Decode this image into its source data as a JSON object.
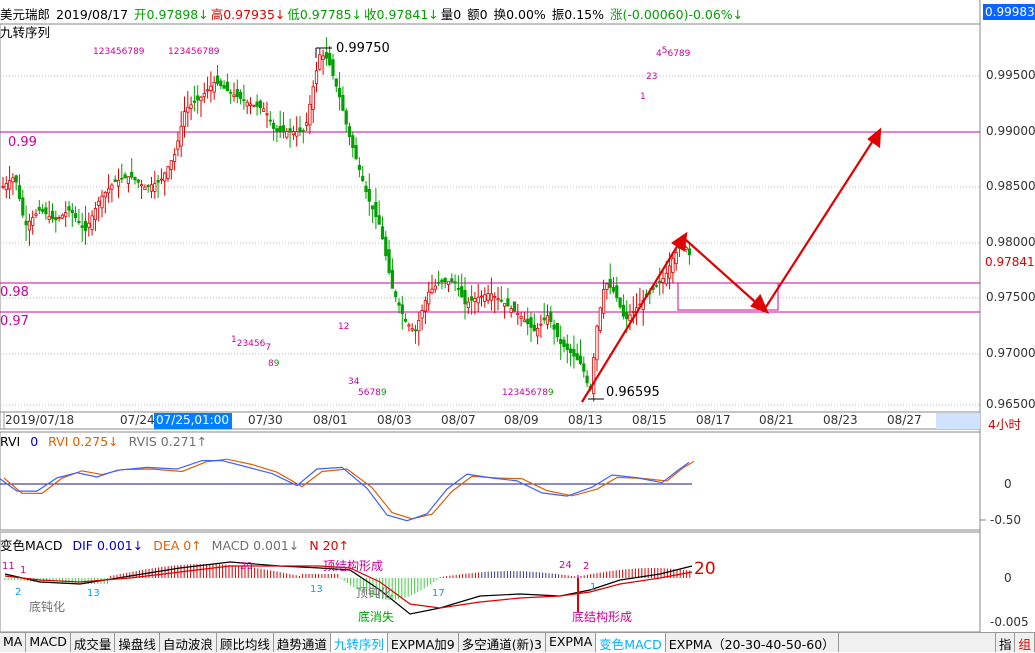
{
  "header": {
    "symbol": "美元瑞郎",
    "date": "2019/08/17",
    "open": "开0.97898↓",
    "high": "高0.97935↓",
    "low": "低0.97785↓",
    "close": "收0.97841↓",
    "volume": "量0",
    "amount": "额0",
    "turnover": "换0.00%",
    "amplitude": "振0.15%",
    "change": "涨(-0.00060)-0.06%↓",
    "indicator_name": "九转序列"
  },
  "price_axis": {
    "top_box": "0.99983",
    "current_price": "0.97841",
    "ticks": [
      "0.99500",
      "0.99000",
      "0.98500",
      "0.98000",
      "0.97500",
      "0.97000",
      "0.96500"
    ]
  },
  "lines": {
    "l099": "0.99",
    "l098": "0.98",
    "l097": "0.97"
  },
  "price_annotations": {
    "high_label": "0.99750",
    "low_label": "0.96595"
  },
  "nine_labels": {
    "a": "123456789",
    "b": "123456789",
    "c": "4",
    "c2": "5",
    "c3": "6789",
    "d": "23",
    "e": "1",
    "f": "12",
    "g": "1",
    "g2": "23456",
    "g3": "7",
    "g4": "8",
    "g5": "9",
    "h": "34",
    "h2": "5678",
    "h3": "9",
    "i": "12345678",
    "i2": "9"
  },
  "x_axis": {
    "labels": [
      "2019/07/18",
      "07/24",
      "07/25,01:00",
      "07/30",
      "08/01",
      "08/03",
      "08/07",
      "08/09",
      "08/13",
      "08/15",
      "08/17",
      "08/21",
      "08/23",
      "08/27"
    ],
    "period": "4小时"
  },
  "rvi": {
    "title": "RVI",
    "v0": "0",
    "rvi": "RVI 0.275↓",
    "rvis": "RVIS 0.271↑",
    "ticks": [
      "0",
      "-0.50"
    ]
  },
  "macd": {
    "title": "变色MACD",
    "dif": "DIF 0.001↓",
    "dea": "DEA 0↑",
    "macd": "MACD 0.001↓",
    "n": "N 20↑",
    "ticks": [
      "0",
      "-0.005"
    ],
    "big_num": "20",
    "annotations": {
      "a11": "11",
      "a1": "1",
      "a2": "2",
      "a13": "13",
      "a29": "29",
      "a13b": "13",
      "a17": "17",
      "a24": "24",
      "a2b": "2",
      "a1b": "1",
      "t1": "底钝化",
      "t2": "顶结构形成",
      "t3": "顶钝化",
      "t4": "底消失",
      "t5": "底结构形成"
    }
  },
  "toolbar": {
    "items": [
      "MA",
      "MACD",
      "成交量",
      "操盘线",
      "自动波浪",
      "顾比均线",
      "趋势通道",
      "九转序列",
      "EXPMA加9",
      "多空通道(新)3",
      "EXPMA",
      "变色MACD",
      "EXPMA（20-30-40-50-60）"
    ],
    "active": [
      "九转序列",
      "变色MACD"
    ],
    "right1": "指",
    "right2": "组"
  },
  "colors": {
    "up": "#e00000",
    "down": "#00a000",
    "magenta_line": "#d000a0",
    "arrow": "#e00000"
  },
  "chart_data": [
    {
      "type": "candlestick",
      "title": "美元瑞郎 2019/08/17",
      "ylim": [
        0.9645,
        0.99983
      ],
      "x": [
        "2019/07/18",
        "07/24",
        "07/30",
        "08/01",
        "08/03",
        "08/07",
        "08/09",
        "08/13",
        "08/15",
        "08/17"
      ],
      "series": [
        {
          "name": "收",
          "values": [
            0.985,
            0.986,
            0.9945,
            0.9895,
            0.9725,
            0.974,
            0.973,
            0.966,
            0.977,
            0.97841
          ]
        }
      ],
      "annotations": [
        "0.99750",
        "0.96595"
      ]
    },
    {
      "type": "line",
      "title": "RVI",
      "series": [
        {
          "name": "RVI",
          "values": [
            0.1,
            -0.1,
            0.2,
            0.25,
            0.1,
            -0.2,
            -0.3,
            -0.6,
            -0.2,
            0.0,
            -0.05,
            -0.1,
            0.1,
            0.0,
            0.275
          ]
        },
        {
          "name": "RVIS",
          "values": [
            0.05,
            -0.05,
            0.15,
            0.25,
            0.15,
            -0.15,
            -0.3,
            -0.55,
            -0.25,
            -0.05,
            -0.05,
            -0.1,
            0.05,
            0.05,
            0.271
          ]
        }
      ],
      "ylim": [
        -0.6,
        0.6
      ]
    },
    {
      "type": "bar",
      "title": "变色MACD",
      "series": [
        {
          "name": "MACD",
          "values": [
            0.0005,
            -0.001,
            0.0015,
            0.001,
            -0.002,
            -0.003,
            0.001,
            0.0008,
            0.0002,
            0.001
          ]
        }
      ],
      "ylim": [
        -0.005,
        0.002
      ]
    }
  ]
}
